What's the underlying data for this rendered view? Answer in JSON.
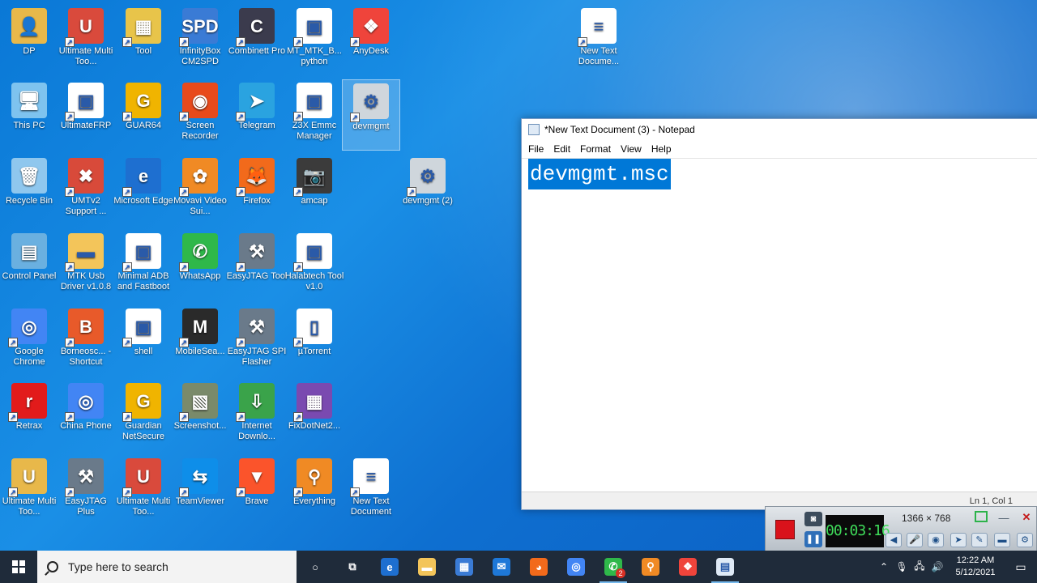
{
  "desktop": {
    "icons": [
      {
        "label": "DP",
        "icon": "user-folder-icon",
        "bg": "#e8b84a",
        "glyph": "👤"
      },
      {
        "label": "Ultimate Multi Too...",
        "icon": "ultimate-multi-tool-icon",
        "bg": "#d94a3c",
        "glyph": "U"
      },
      {
        "label": "Tool",
        "icon": "winrar-folder-icon",
        "bg": "#e8c44a",
        "glyph": "▦"
      },
      {
        "label": "InfinityBox CM2SPD",
        "icon": "infinitybox-icon",
        "bg": "#3a7bd5",
        "glyph": "SPD"
      },
      {
        "label": "Combinett Pro",
        "icon": "combinett-icon",
        "bg": "#3b3b4d",
        "glyph": "C"
      },
      {
        "label": "MT_MTK_B... python",
        "icon": "window-shortcut-icon",
        "bg": "#ffffff",
        "glyph": "▣"
      },
      {
        "label": "AnyDesk",
        "icon": "anydesk-icon",
        "bg": "#ef443b",
        "glyph": "❖"
      },
      {
        "label": "This PC",
        "icon": "computer-icon",
        "bg": "#7ec3ef",
        "glyph": "🖥"
      },
      {
        "label": "UltimateFRP",
        "icon": "window-shortcut-icon",
        "bg": "#ffffff",
        "glyph": "▣"
      },
      {
        "label": "GUAR64",
        "icon": "guardian-icon",
        "bg": "#f0b400",
        "glyph": "G"
      },
      {
        "label": "Screen Recorder",
        "icon": "screen-recorder-icon",
        "bg": "#e84a1c",
        "glyph": "◉"
      },
      {
        "label": "Telegram",
        "icon": "telegram-icon",
        "bg": "#2aa3e0",
        "glyph": "➤"
      },
      {
        "label": "Z3X Emmc Manager",
        "icon": "window-shortcut-icon",
        "bg": "#ffffff",
        "glyph": "▣"
      },
      {
        "label": "devmgmt",
        "icon": "device-manager-icon",
        "bg": "#cfd6dc",
        "glyph": "⚙"
      },
      {
        "label": "Recycle Bin",
        "icon": "recycle-bin-icon",
        "bg": "#8fc7ee",
        "glyph": "🗑"
      },
      {
        "label": "UMTv2 Support ...",
        "icon": "umt-support-icon",
        "bg": "#d84a3a",
        "glyph": "✖"
      },
      {
        "label": "Microsoft Edge",
        "icon": "edge-icon",
        "bg": "#1e6fd0",
        "glyph": "e"
      },
      {
        "label": "Movavi Video Sui...",
        "icon": "movavi-icon",
        "bg": "#f08a24",
        "glyph": "✿"
      },
      {
        "label": "Firefox",
        "icon": "firefox-icon",
        "bg": "#f26a1b",
        "glyph": "🦊"
      },
      {
        "label": "amcap",
        "icon": "camera-icon",
        "bg": "#3b3b3b",
        "glyph": "📷"
      },
      {
        "label": "devmgmt (2)",
        "icon": "device-manager-icon",
        "bg": "#cfd6dc",
        "glyph": "⚙"
      },
      {
        "label": "Control Panel",
        "icon": "control-panel-icon",
        "bg": "#6ab0e0",
        "glyph": "▤"
      },
      {
        "label": "MTK Usb Driver v1.0.8",
        "icon": "folder-icon",
        "bg": "#f3c55a",
        "glyph": "▬"
      },
      {
        "label": "Minimal ADB and Fastboot",
        "icon": "window-shortcut-icon",
        "bg": "#ffffff",
        "glyph": "▣"
      },
      {
        "label": "WhatsApp",
        "icon": "whatsapp-icon",
        "bg": "#2fb84a",
        "glyph": "✆"
      },
      {
        "label": "EasyJTAG Tool",
        "icon": "easyjtag-icon",
        "bg": "#6a7a8a",
        "glyph": "⚒"
      },
      {
        "label": "Halabtech Tool v1.0",
        "icon": "window-shortcut-icon",
        "bg": "#ffffff",
        "glyph": "▣"
      },
      {
        "label": "Google Chrome",
        "icon": "chrome-icon",
        "bg": "#4285f4",
        "glyph": "◎"
      },
      {
        "label": "Borneosc... - Shortcut",
        "icon": "borneo-icon",
        "bg": "#e85a2a",
        "glyph": "B"
      },
      {
        "label": "shell",
        "icon": "window-shortcut-icon",
        "bg": "#ffffff",
        "glyph": "▣"
      },
      {
        "label": "MobileSea...",
        "icon": "mobilesea-icon",
        "bg": "#2a2a2a",
        "glyph": "M"
      },
      {
        "label": "EasyJTAG SPI Flasher",
        "icon": "easyjtag-icon",
        "bg": "#6a7a8a",
        "glyph": "⚒"
      },
      {
        "label": "µTorrent",
        "icon": "file-icon",
        "bg": "#ffffff",
        "glyph": "▯"
      },
      {
        "label": "Retrax",
        "icon": "retrax-icon",
        "bg": "#e21b1b",
        "glyph": "r"
      },
      {
        "label": "China Phone",
        "icon": "chrome-icon",
        "bg": "#4285f4",
        "glyph": "◎"
      },
      {
        "label": "Guardian NetSecure",
        "icon": "guardian-icon",
        "bg": "#f0b400",
        "glyph": "G"
      },
      {
        "label": "Screenshot...",
        "icon": "image-icon",
        "bg": "#7a8a6a",
        "glyph": "▧"
      },
      {
        "label": "Internet Downlo...",
        "icon": "idm-icon",
        "bg": "#3aa34a",
        "glyph": "⇩"
      },
      {
        "label": "FixDotNet2...",
        "icon": "winrar-icon",
        "bg": "#7a4ab0",
        "glyph": "▦"
      },
      {
        "label": "Ultimate Multi Too...",
        "icon": "ultimate-multi-tool-icon",
        "bg": "#e8b84a",
        "glyph": "U"
      },
      {
        "label": "EasyJTAG Plus",
        "icon": "easyjtag-icon",
        "bg": "#6a7a8a",
        "glyph": "⚒"
      },
      {
        "label": "Ultimate Multi Too...",
        "icon": "ultimate-multi-tool-icon",
        "bg": "#d94a3c",
        "glyph": "U"
      },
      {
        "label": "TeamViewer",
        "icon": "teamviewer-icon",
        "bg": "#0e8ee9",
        "glyph": "⇆"
      },
      {
        "label": "Brave",
        "icon": "brave-icon",
        "bg": "#fb542b",
        "glyph": "▼"
      },
      {
        "label": "Everything",
        "icon": "everything-search-icon",
        "bg": "#f08a24",
        "glyph": "⚲"
      },
      {
        "label": "New Text Document",
        "icon": "text-document-icon",
        "bg": "#ffffff",
        "glyph": "≡"
      },
      {
        "label": "New Text Docume...",
        "icon": "text-document-icon",
        "bg": "#ffffff",
        "glyph": "≡"
      }
    ]
  },
  "notepad": {
    "title": "*New Text Document (3) - Notepad",
    "menu": [
      "File",
      "Edit",
      "Format",
      "View",
      "Help"
    ],
    "content": "devmgmt.msc",
    "status": "Ln 1, Col 1"
  },
  "recorder": {
    "timer": "00:03:16",
    "resolution": "1366 × 768"
  },
  "taskbar": {
    "search_placeholder": "Type here to search",
    "apps": [
      {
        "name": "cortana",
        "glyph": "○",
        "bg": "transparent"
      },
      {
        "name": "task-view",
        "glyph": "⧉",
        "bg": "transparent"
      },
      {
        "name": "edge",
        "glyph": "e",
        "bg": "#1e6fd0"
      },
      {
        "name": "file-explorer",
        "glyph": "▬",
        "bg": "#f3c55a"
      },
      {
        "name": "store",
        "glyph": "▦",
        "bg": "#3a7bd5"
      },
      {
        "name": "mail",
        "glyph": "✉",
        "bg": "#1e78d8"
      },
      {
        "name": "firefox",
        "glyph": "◕",
        "bg": "#f26a1b"
      },
      {
        "name": "chrome",
        "glyph": "◎",
        "bg": "#4285f4"
      },
      {
        "name": "whatsapp",
        "glyph": "✆",
        "bg": "#2fb84a"
      },
      {
        "name": "everything-search",
        "glyph": "⚲",
        "bg": "#f08a24"
      },
      {
        "name": "anydesk",
        "glyph": "❖",
        "bg": "#ef443b"
      },
      {
        "name": "notepad",
        "glyph": "▤",
        "bg": "#dfeaf6"
      }
    ],
    "whatsapp_badge": "2",
    "time": "12:22 AM",
    "date": "5/12/2021"
  }
}
